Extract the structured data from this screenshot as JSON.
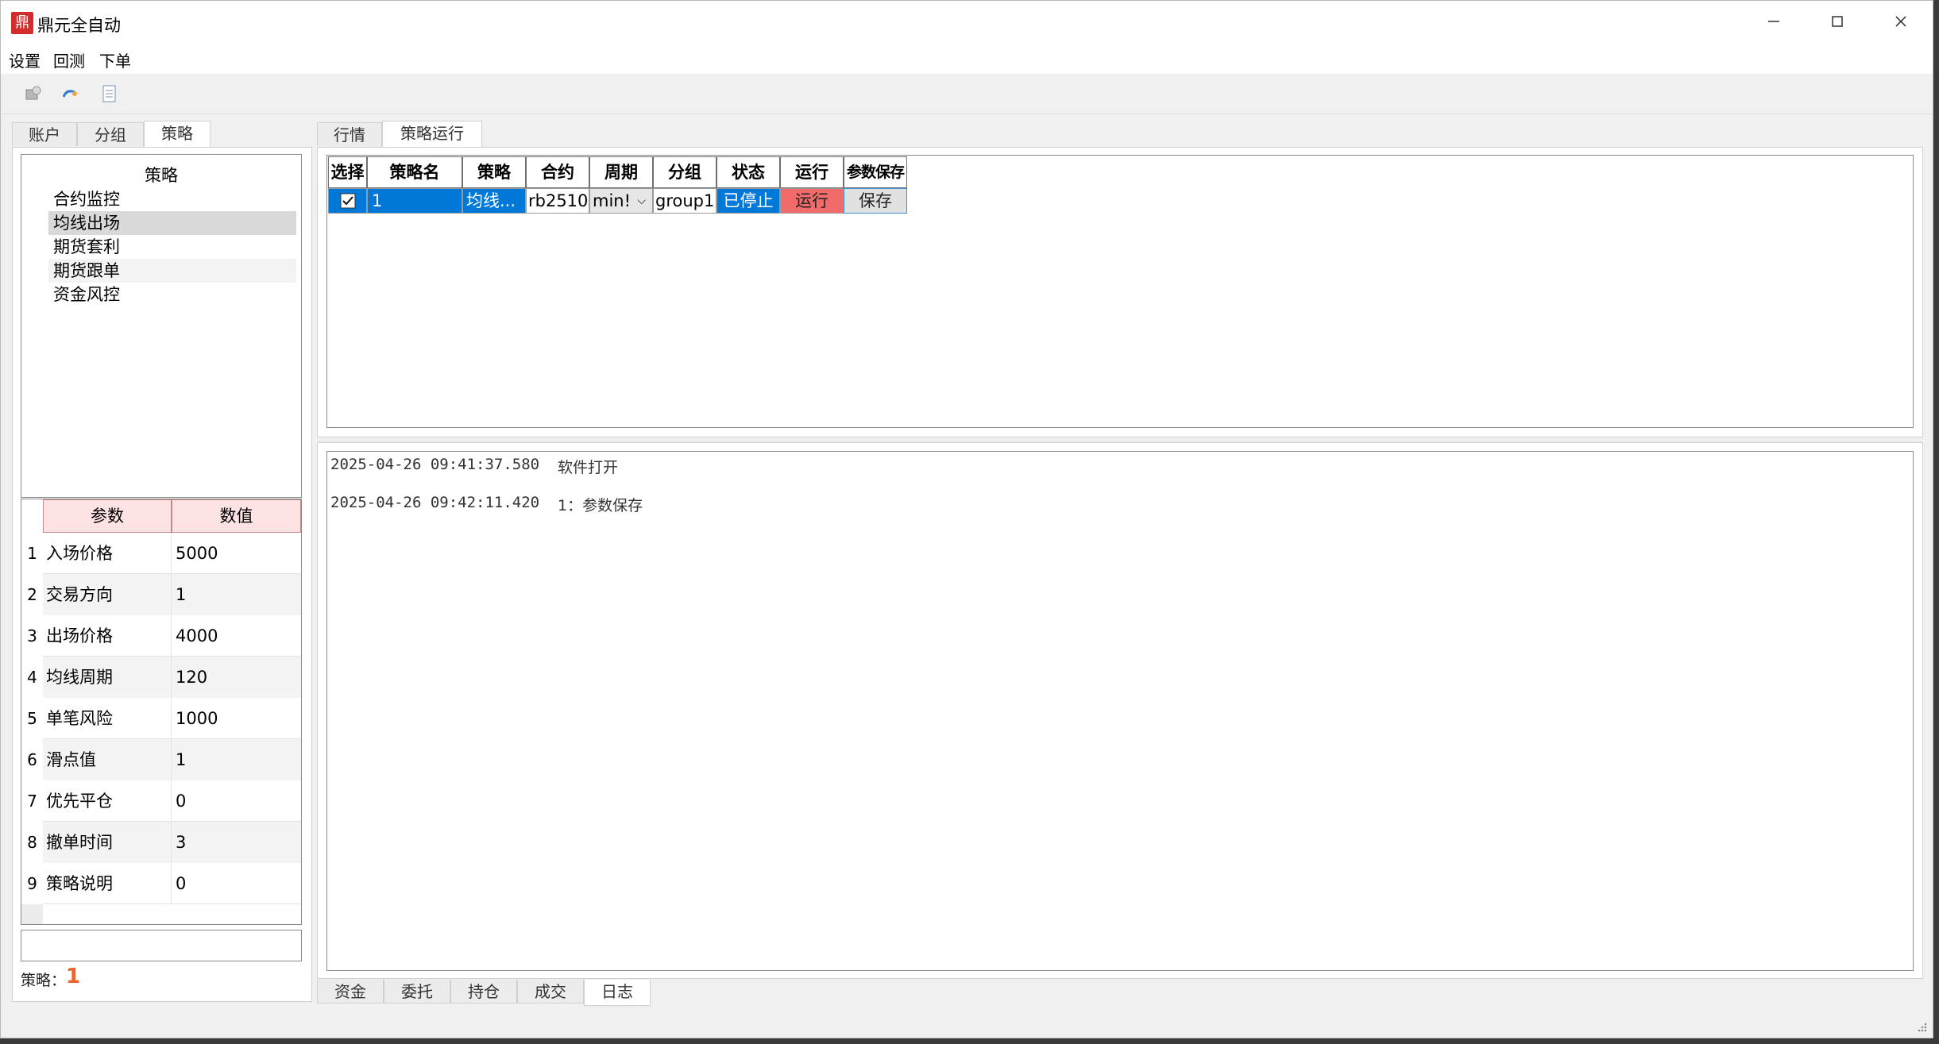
{
  "window": {
    "title": "鼎元全自动",
    "icon": "app-logo-icon",
    "controls": [
      "minimize-icon",
      "maximize-icon",
      "close-icon"
    ]
  },
  "menu": [
    "设置",
    "回测",
    "下单"
  ],
  "toolbar": [
    "connect-icon",
    "refresh-icon",
    "document-icon"
  ],
  "left_tabs": {
    "items": [
      "账户",
      "分组",
      "策略"
    ],
    "active": "策略"
  },
  "strategy_list": {
    "header": "策略",
    "items": [
      "合约监控",
      "均线出场",
      "期货套利",
      "期货跟单",
      "资金风控"
    ],
    "selected": "均线出场"
  },
  "param_table": {
    "headers": [
      "参数",
      "数值"
    ],
    "rows": [
      {
        "num": "1",
        "name": "入场价格",
        "value": "5000"
      },
      {
        "num": "2",
        "name": "交易方向",
        "value": "1"
      },
      {
        "num": "3",
        "name": "出场价格",
        "value": "4000"
      },
      {
        "num": "4",
        "name": "均线周期",
        "value": "120"
      },
      {
        "num": "5",
        "name": "单笔风险",
        "value": "1000"
      },
      {
        "num": "6",
        "name": "滑点值",
        "value": "1"
      },
      {
        "num": "7",
        "name": "优先平仓",
        "value": "0"
      },
      {
        "num": "8",
        "name": "撤单时间",
        "value": "3"
      },
      {
        "num": "9",
        "name": "策略说明",
        "value": "0"
      }
    ]
  },
  "strategy_input": {
    "value": ""
  },
  "status": {
    "label": "策略：",
    "count": "1"
  },
  "right_tabs": {
    "items": [
      "行情",
      "策略运行"
    ],
    "active": "策略运行"
  },
  "run_grid": {
    "headers": [
      "选择",
      "策略名",
      "策略",
      "合约",
      "周期",
      "分组",
      "状态",
      "运行",
      "参数保存"
    ],
    "row": {
      "checked": true,
      "name": "1",
      "strategy": "均线...",
      "contract": "rb2510",
      "period": "min!",
      "group": "group1",
      "status": "已停止",
      "run_button": "运行",
      "save_button": "保存"
    },
    "colors": {
      "selected": "#0078d7",
      "run": "#f26b6b",
      "save": "#e1e1e1"
    }
  },
  "log": [
    {
      "time": "2025-04-26 09:41:37.580",
      "message": "软件打开"
    },
    {
      "time": "2025-04-26 09:42:11.420",
      "message": "1：参数保存"
    }
  ],
  "bottom_tabs": {
    "items": [
      "资金",
      "委托",
      "持仓",
      "成交",
      "日志"
    ],
    "active": "日志"
  }
}
